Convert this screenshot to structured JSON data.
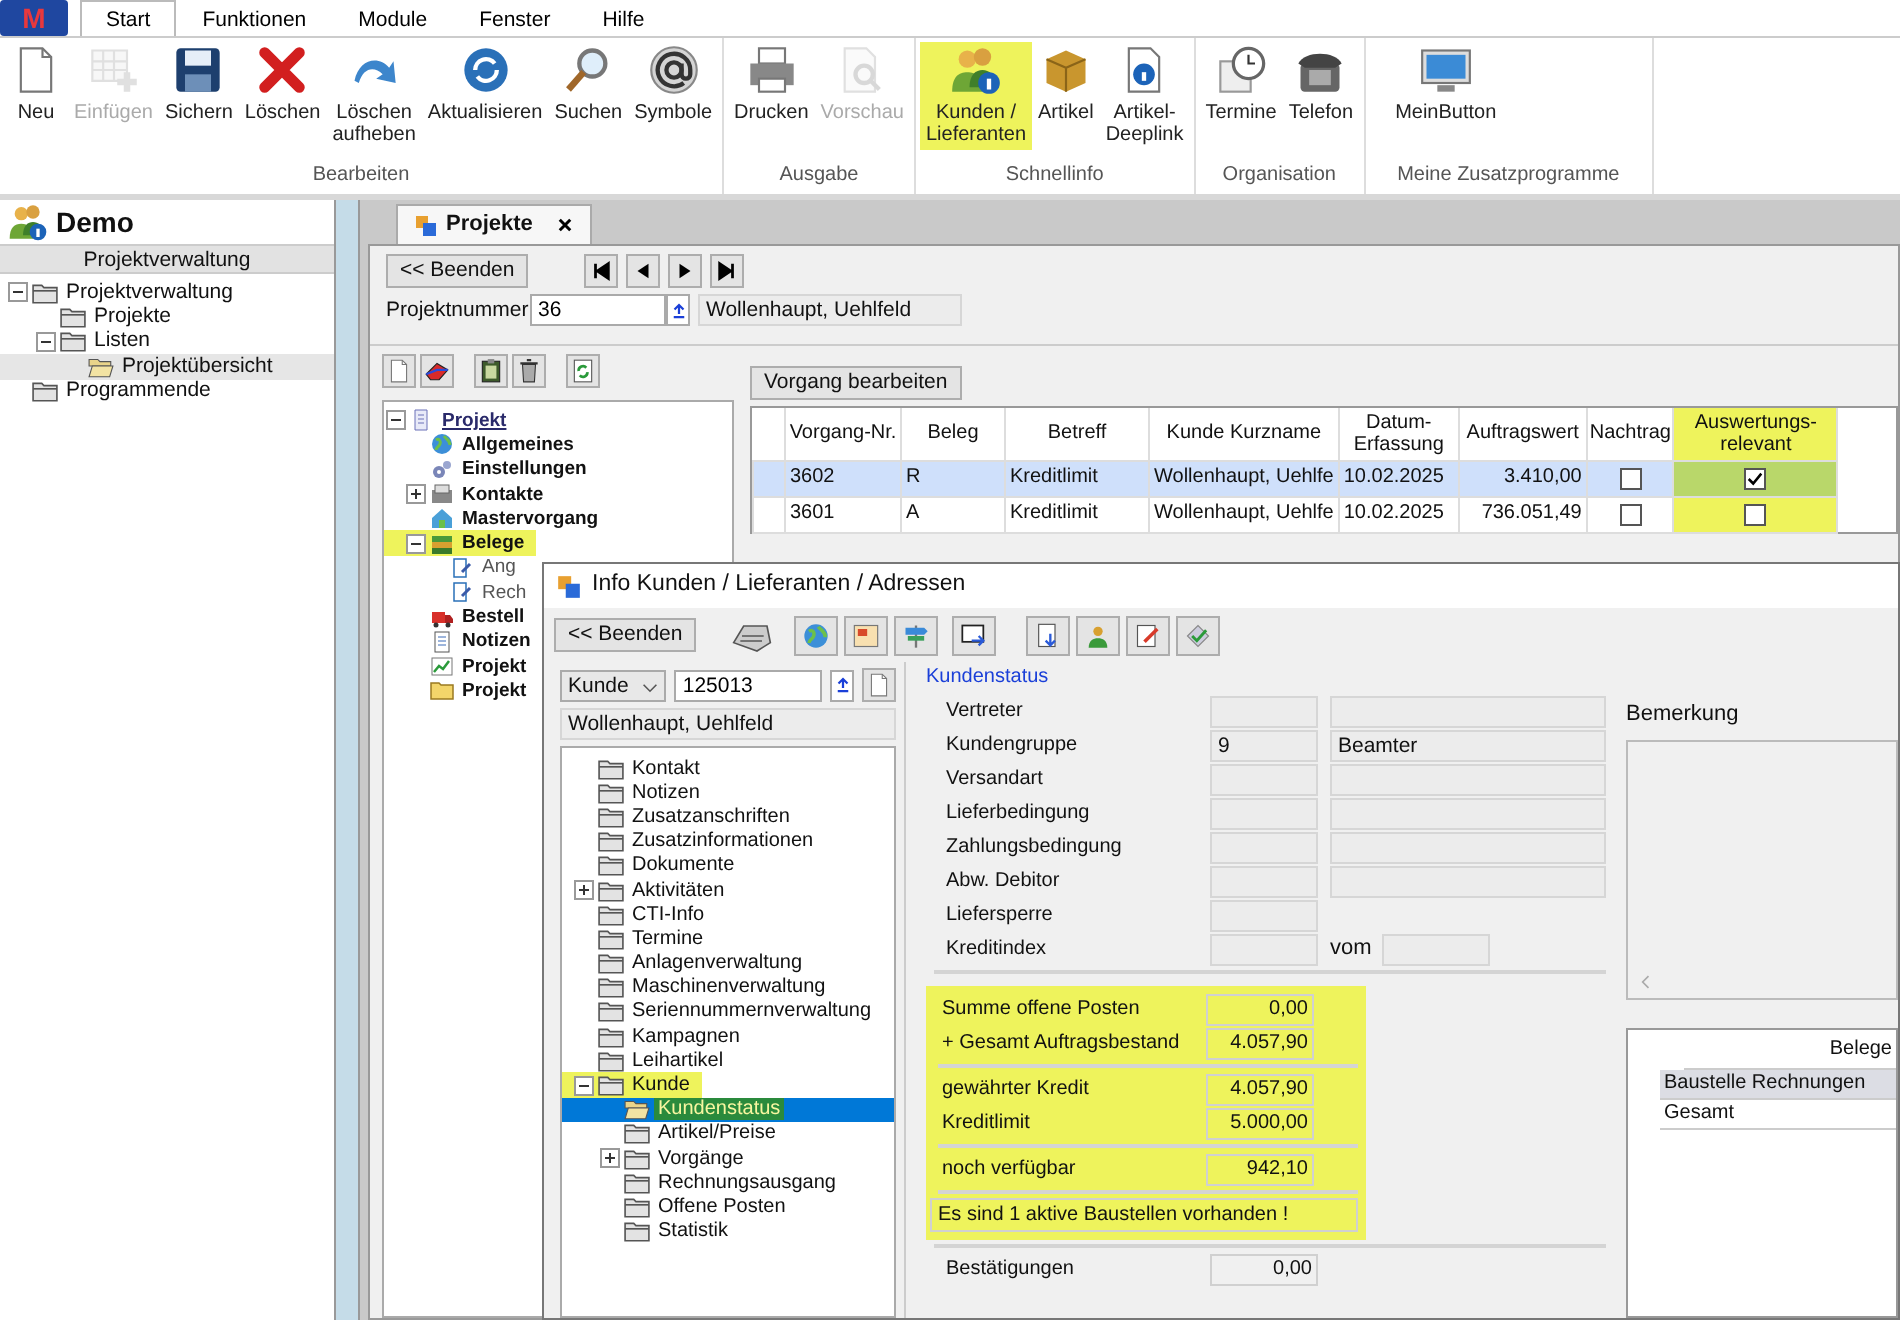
{
  "app_menu": {
    "logo": "M"
  },
  "ribbon_tabs": [
    {
      "label": "Start",
      "selected": true
    },
    {
      "label": "Funktionen",
      "selected": false
    },
    {
      "label": "Module",
      "selected": false
    },
    {
      "label": "Fenster",
      "selected": false
    },
    {
      "label": "Hilfe",
      "selected": false
    }
  ],
  "ribbon_groups": [
    {
      "title": "Bearbeiten",
      "buttons": [
        {
          "lines": [
            "Neu"
          ],
          "disabled": false,
          "highlighted": false
        },
        {
          "lines": [
            "Einfügen"
          ],
          "disabled": true,
          "highlighted": false
        },
        {
          "lines": [
            "Sichern"
          ],
          "disabled": false,
          "highlighted": false
        },
        {
          "lines": [
            "Löschen"
          ],
          "disabled": false,
          "highlighted": false
        },
        {
          "lines": [
            "Löschen",
            "aufheben"
          ],
          "disabled": false,
          "highlighted": false
        },
        {
          "lines": [
            "Aktualisieren"
          ],
          "disabled": false,
          "highlighted": false
        },
        {
          "lines": [
            "Suchen"
          ],
          "disabled": false,
          "highlighted": false
        },
        {
          "lines": [
            "Symbole"
          ],
          "disabled": false,
          "highlighted": false
        }
      ]
    },
    {
      "title": "Ausgabe",
      "buttons": [
        {
          "lines": [
            "Drucken"
          ],
          "disabled": false,
          "highlighted": false
        },
        {
          "lines": [
            "Vorschau"
          ],
          "disabled": true,
          "highlighted": false
        }
      ]
    },
    {
      "title": "Schnellinfo",
      "buttons": [
        {
          "lines": [
            "Kunden /",
            "Lieferanten"
          ],
          "disabled": false,
          "highlighted": true
        },
        {
          "lines": [
            "Artikel"
          ],
          "disabled": false,
          "highlighted": false
        },
        {
          "lines": [
            "Artikel-",
            "Deeplink"
          ],
          "disabled": false,
          "highlighted": false
        }
      ]
    },
    {
      "title": "Organisation",
      "buttons": [
        {
          "lines": [
            "Termine"
          ],
          "disabled": false,
          "highlighted": false
        },
        {
          "lines": [
            "Telefon"
          ],
          "disabled": false,
          "highlighted": false
        }
      ]
    },
    {
      "title": "Meine Zusatzprogramme",
      "buttons": [
        {
          "lines": [
            "MeinButton"
          ],
          "disabled": false,
          "highlighted": false
        }
      ]
    }
  ],
  "sidebar": {
    "title": "Demo",
    "section": "Projektverwaltung",
    "tree": [
      {
        "label": "Projektverwaltung",
        "selected": false,
        "expanded": true,
        "children": [
          {
            "label": "Projekte",
            "selected": false
          },
          {
            "label": "Listen",
            "selected": false,
            "expanded": true,
            "children": [
              {
                "label": "Projektübersicht",
                "selected": true
              }
            ]
          }
        ]
      },
      {
        "label": "Programmende",
        "selected": false
      }
    ]
  },
  "document_tabs": [
    {
      "label": "Projekte",
      "selected": true
    }
  ],
  "project": {
    "back_button": "<< Beenden",
    "number_label": "Projektnummer",
    "number_value": "36",
    "customer": "Wollenhaupt, Uehlfeld",
    "tree": [
      {
        "label": "Projekt",
        "highlighted": false,
        "expanded": true,
        "children": [
          {
            "label": "Allgemeines",
            "highlighted": false
          },
          {
            "label": "Einstellungen",
            "highlighted": false
          },
          {
            "label": "Kontakte",
            "highlighted": false,
            "expanded": false
          },
          {
            "label": "Mastervorgang",
            "highlighted": false
          },
          {
            "label": "Belege",
            "highlighted": true,
            "expanded": true,
            "children": [
              {
                "label": "Ang",
                "highlighted": false
              },
              {
                "label": "Rech",
                "highlighted": false
              }
            ]
          },
          {
            "label": "Bestell",
            "highlighted": false
          },
          {
            "label": "Notizen",
            "highlighted": false
          },
          {
            "label": "Projekt",
            "highlighted": false
          },
          {
            "label": "Projekt",
            "highlighted": false
          }
        ]
      }
    ],
    "edit_button": "Vorgang bearbeiten",
    "table": {
      "columns": [
        {
          "label": "Vorgang-Nr.",
          "highlighted": false
        },
        {
          "label": "Beleg",
          "highlighted": false
        },
        {
          "label": "Betreff",
          "highlighted": false
        },
        {
          "label": "Kunde Kurzname",
          "highlighted": false
        },
        {
          "label": "Datum-Erfassung",
          "highlighted": false
        },
        {
          "label": "Auftragswert",
          "highlighted": false
        },
        {
          "label": "Nachtrag",
          "highlighted": false
        },
        {
          "label": "Auswertungs-relevant",
          "highlighted": true
        }
      ],
      "rows": [
        {
          "number": "3602",
          "receipt": "R",
          "subject": "Kreditlimit",
          "customer": "Wollenhaupt, Uehlfe",
          "date": "10.02.2025",
          "amount": "3.410,00",
          "supplement": false,
          "relevant": true,
          "selected": true
        },
        {
          "number": "3601",
          "receipt": "A",
          "subject": "Kreditlimit",
          "customer": "Wollenhaupt, Uehlfe",
          "date": "10.02.2025",
          "amount": "736.051,49",
          "supplement": false,
          "relevant": false,
          "selected": false
        }
      ]
    }
  },
  "dialog": {
    "title": "Info Kunden / Lieferanten / Adressen",
    "back_button": "<< Beenden",
    "type_select": "Kunde",
    "number_value": "125013",
    "name": "Wollenhaupt, Uehlfeld",
    "tree": [
      {
        "label": "Kontakt",
        "selected": false,
        "highlighted": false
      },
      {
        "label": "Notizen",
        "selected": false,
        "highlighted": false
      },
      {
        "label": "Zusatzanschriften",
        "selected": false,
        "highlighted": false
      },
      {
        "label": "Zusatzinformationen",
        "selected": false,
        "highlighted": false
      },
      {
        "label": "Dokumente",
        "selected": false,
        "highlighted": false
      },
      {
        "label": "Aktivitäten",
        "selected": false,
        "highlighted": false,
        "expanded": false
      },
      {
        "label": "CTI-Info",
        "selected": false,
        "highlighted": false
      },
      {
        "label": "Termine",
        "selected": false,
        "highlighted": false
      },
      {
        "label": "Anlagenverwaltung",
        "selected": false,
        "highlighted": false
      },
      {
        "label": "Maschinenverwaltung",
        "selected": false,
        "highlighted": false
      },
      {
        "label": "Seriennummernverwaltung",
        "selected": false,
        "highlighted": false
      },
      {
        "label": "Kampagnen",
        "selected": false,
        "highlighted": false
      },
      {
        "label": "Leihartikel",
        "selected": false,
        "highlighted": false
      },
      {
        "label": "Kunde",
        "selected": false,
        "highlighted": true,
        "expanded": true,
        "children": [
          {
            "label": "Kundenstatus",
            "selected": true,
            "highlighted": true
          },
          {
            "label": "Artikel/Preise",
            "selected": false,
            "highlighted": false
          },
          {
            "label": "Vorgänge",
            "selected": false,
            "highlighted": false,
            "expanded": false
          },
          {
            "label": "Rechnungsausgang",
            "selected": false,
            "highlighted": false
          },
          {
            "label": "Offene Posten",
            "selected": false,
            "highlighted": false
          },
          {
            "label": "Statistik",
            "selected": false,
            "highlighted": false
          }
        ]
      }
    ],
    "status": {
      "legend": "Kundenstatus",
      "fields": [
        {
          "label": "Vertreter",
          "kind": "pair"
        },
        {
          "label": "Kundengruppe",
          "kind": "pair",
          "code": "9",
          "text": "Beamter"
        },
        {
          "label": "Versandart",
          "kind": "pair"
        },
        {
          "label": "Lieferbedingung",
          "kind": "pair"
        },
        {
          "label": "Zahlungsbedingung",
          "kind": "pair"
        },
        {
          "label": "Abw. Debitor",
          "kind": "pair"
        },
        {
          "label": "Liefersperre",
          "kind": "single"
        },
        {
          "label": "Kreditindex",
          "kind": "dated",
          "date_label": "vom"
        }
      ],
      "summary": {
        "highlighted": true,
        "groups": [
          [
            {
              "label": "Summe offene Posten",
              "value": "0,00"
            },
            {
              "label": "+ Gesamt Auftragsbestand",
              "value": "4.057,90"
            }
          ],
          [
            {
              "label": "gewährter Kredit",
              "value": "4.057,90"
            },
            {
              "label": "Kreditlimit",
              "value": "5.000,00"
            }
          ],
          [
            {
              "label": "noch verfügbar",
              "value": "942,10"
            }
          ]
        ],
        "message": "Es sind 1 aktive Baustellen vorhanden !"
      },
      "after": [
        {
          "label": "Bestätigungen",
          "value": "0,00"
        }
      ]
    },
    "remark": {
      "label": "Bemerkung"
    },
    "receipts": {
      "column": "Belege",
      "rows": [
        {
          "label": "Baustelle Rechnungen",
          "selected": true
        },
        {
          "label": "Gesamt",
          "selected": false
        }
      ]
    }
  }
}
